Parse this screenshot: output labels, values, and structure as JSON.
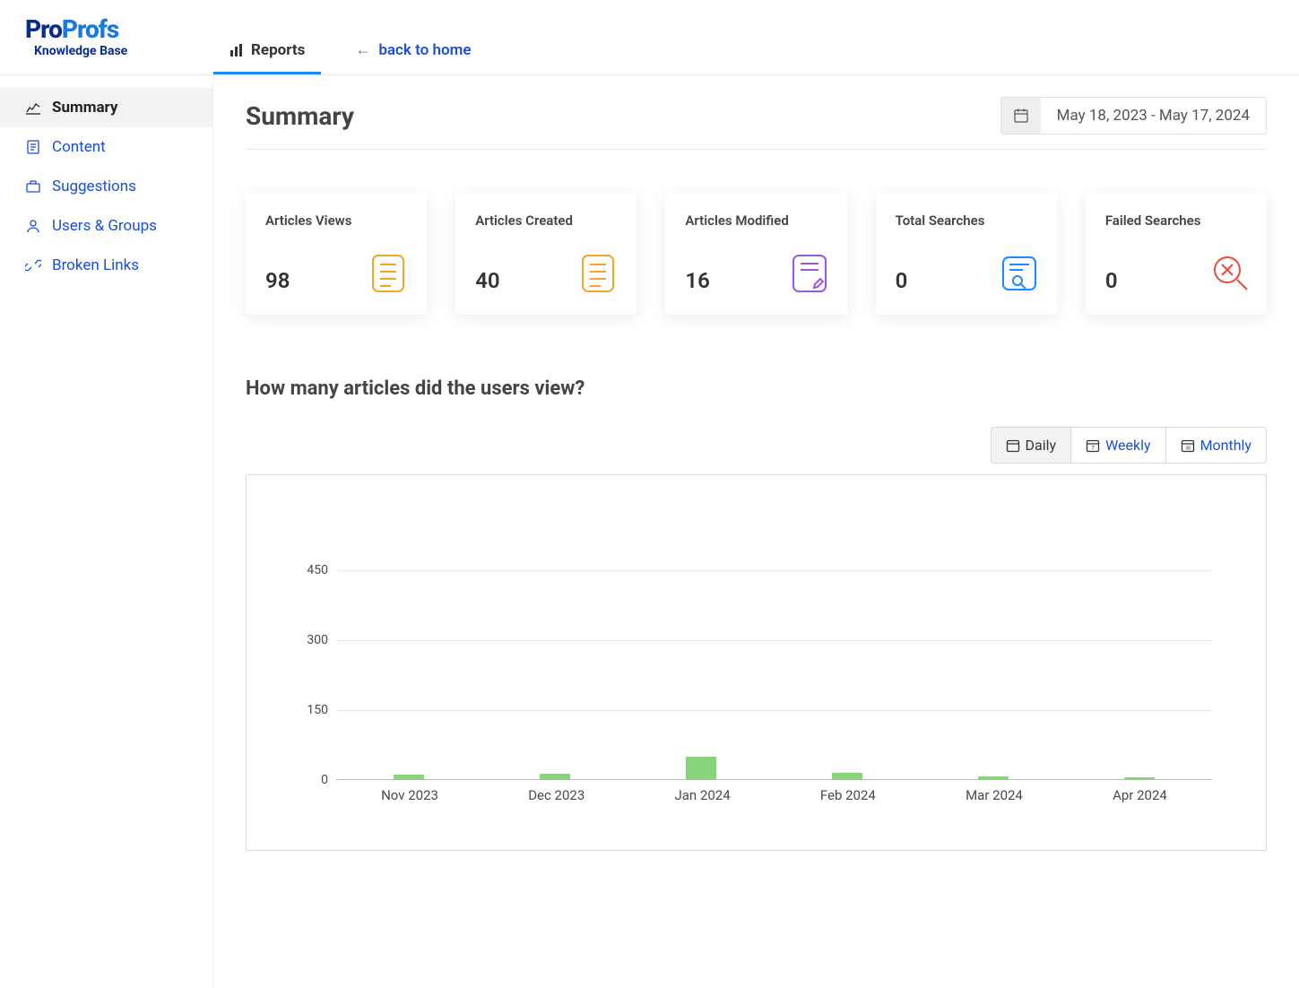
{
  "brand": {
    "part1": "Pro",
    "part2": "Profs",
    "sub": "Knowledge Base"
  },
  "topnav": {
    "reports": "Reports",
    "back": "back to home"
  },
  "sidebar": {
    "items": [
      {
        "label": "Summary"
      },
      {
        "label": "Content"
      },
      {
        "label": "Suggestions"
      },
      {
        "label": "Users & Groups"
      },
      {
        "label": "Broken Links"
      }
    ]
  },
  "page": {
    "title": "Summary",
    "date_range": "May 18, 2023 - May 17, 2024"
  },
  "cards": [
    {
      "label": "Articles Views",
      "value": "98"
    },
    {
      "label": "Articles Created",
      "value": "40"
    },
    {
      "label": "Articles Modified",
      "value": "16"
    },
    {
      "label": "Total Searches",
      "value": "0"
    },
    {
      "label": "Failed Searches",
      "value": "0"
    }
  ],
  "section": {
    "title": "How many articles did the users view?"
  },
  "periods": {
    "daily": "Daily",
    "weekly": "Weekly",
    "monthly": "Monthly"
  },
  "chart_data": {
    "type": "bar",
    "categories": [
      "Nov 2023",
      "Dec 2023",
      "Jan 2024",
      "Feb 2024",
      "Mar 2024",
      "Apr 2024"
    ],
    "values": [
      12,
      14,
      50,
      16,
      8,
      6
    ],
    "title": "How many articles did the users view?",
    "xlabel": "",
    "ylabel": "",
    "ylim": [
      0,
      500
    ],
    "yticks": [
      0,
      150,
      300,
      450
    ]
  }
}
